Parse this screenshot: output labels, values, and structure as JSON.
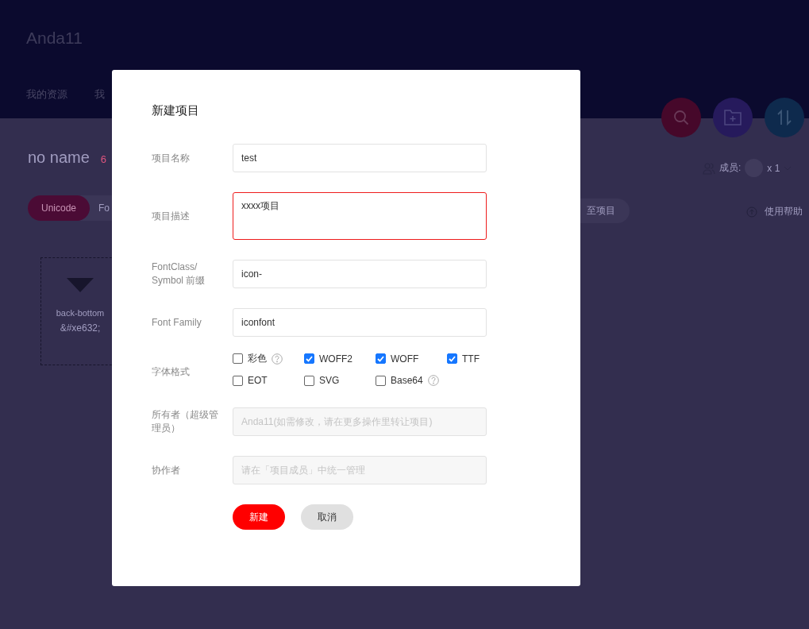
{
  "app": {
    "user": "Anda11",
    "nav": [
      "我的资源",
      "我"
    ]
  },
  "project": {
    "title": "no name",
    "count": "6",
    "tabs": [
      {
        "label": "Unicode",
        "selected": true
      },
      {
        "label": "Fo",
        "selected": false
      }
    ],
    "icons": [
      {
        "name": "back-bottom",
        "code": "&#xe632;"
      }
    ],
    "action_button": "至项目",
    "members_label": "成员:",
    "members_count": "x 1",
    "help": "使用帮助"
  },
  "dialog": {
    "title": "新建项目",
    "fields": [
      {
        "kind": "text",
        "label": "项目名称",
        "value": "test"
      },
      {
        "kind": "textarea",
        "label": "项目描述",
        "value": "xxxx项目",
        "invalid": true
      },
      {
        "kind": "text",
        "label": "FontClass/ Symbol 前缀",
        "value": "icon-"
      },
      {
        "kind": "text",
        "label": "Font Family",
        "value": "iconfont"
      },
      {
        "kind": "checkboxes",
        "label": "字体格式",
        "options": [
          {
            "label": "彩色",
            "checked": false,
            "help": true
          },
          {
            "label": "WOFF2",
            "checked": true,
            "help": false
          },
          {
            "label": "WOFF",
            "checked": true,
            "help": false
          },
          {
            "label": "TTF",
            "checked": true,
            "help": false
          },
          {
            "label": "EOT",
            "checked": false,
            "help": false
          },
          {
            "label": "SVG",
            "checked": false,
            "help": false
          },
          {
            "label": "Base64",
            "checked": false,
            "help": true
          }
        ]
      },
      {
        "kind": "disabled",
        "label": "所有者（超级管理员）",
        "placeholder": "Anda11(如需修改，请在更多操作里转让项目)"
      },
      {
        "kind": "disabled",
        "label": "协作者",
        "placeholder": "请在「项目成员」中统一管理"
      }
    ],
    "buttons": [
      {
        "label": "新建",
        "primary": true
      },
      {
        "label": "取消",
        "primary": false
      }
    ]
  }
}
